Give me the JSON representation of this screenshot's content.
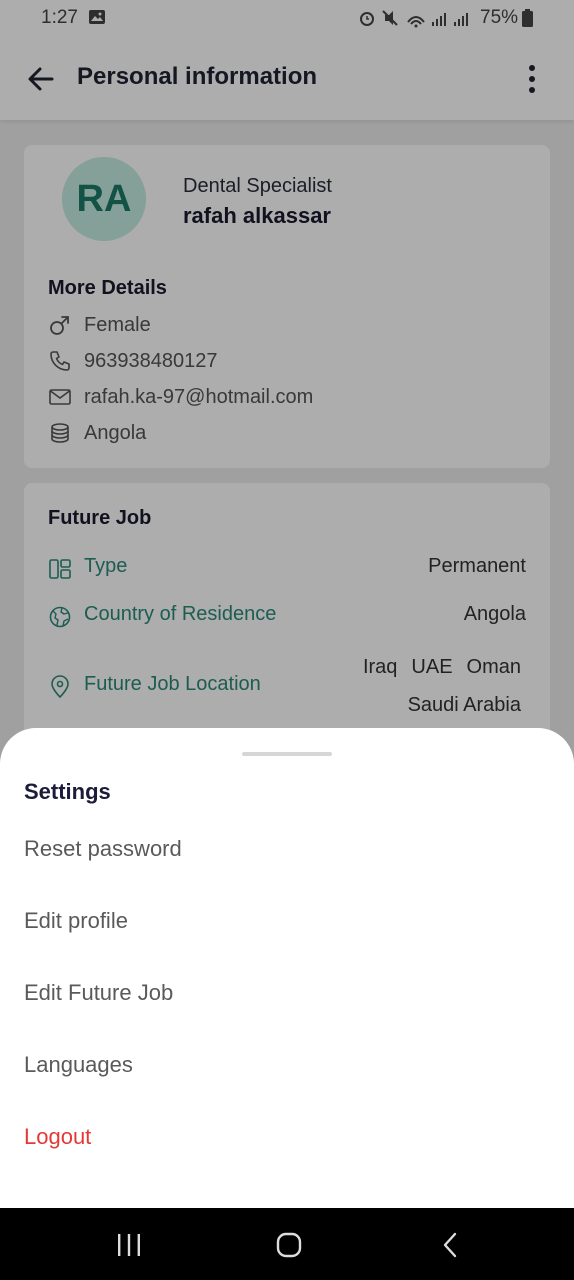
{
  "status_bar": {
    "time": "1:27",
    "battery": "75%"
  },
  "top_bar": {
    "title": "Personal information",
    "back_icon": "arrow-left-icon",
    "menu_icon": "more-vertical-icon"
  },
  "profile": {
    "initials": "RA",
    "profession": "Dental Specialist",
    "name": "rafah alkassar",
    "more_details_heading": "More Details",
    "details": [
      {
        "icon": "gender-icon",
        "text": "Female"
      },
      {
        "icon": "phone-icon",
        "text": "963938480127"
      },
      {
        "icon": "mail-icon",
        "text": "rafah.ka-97@hotmail.com"
      },
      {
        "icon": "coins-icon",
        "text": "Angola"
      }
    ]
  },
  "future_job": {
    "heading": "Future Job",
    "type_label": "Type",
    "type_value": "Permanent",
    "country_label": "Country of Residence",
    "country_value": "Angola",
    "location_label": "Future Job Location",
    "locations": [
      "Iraq",
      "UAE",
      "Oman",
      "Saudi Arabia"
    ]
  },
  "settings_sheet": {
    "title": "Settings",
    "items": [
      "Reset password",
      "Edit profile",
      "Edit Future Job",
      "Languages"
    ],
    "logout": "Logout"
  },
  "colors": {
    "accent_teal": "#2a8a76",
    "avatar_bg": "#c5ebe2",
    "logout_red": "#e53935"
  }
}
